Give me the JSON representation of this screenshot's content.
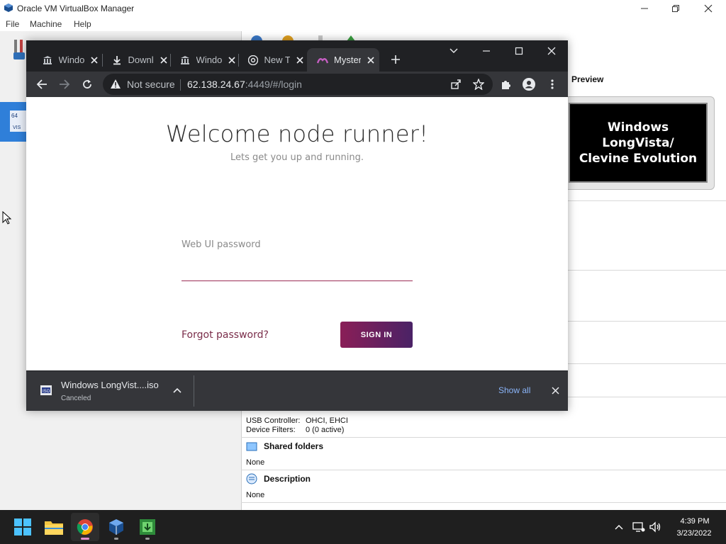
{
  "vbox": {
    "title": "Oracle VM VirtualBox Manager",
    "menu": [
      "File",
      "Machine",
      "Help"
    ],
    "preview_label": "Preview",
    "preview_text_line1": "Windows LongVista/",
    "preview_text_line2": "Clevine Evolution",
    "usb_controller_label": "USB Controller:",
    "usb_controller_value": "OHCI, EHCI",
    "device_filters_label": "Device Filters:",
    "device_filters_value": "0 (0 active)",
    "shared_folders_title": "Shared folders",
    "shared_folders_value": "None",
    "description_title": "Description",
    "description_value": "None"
  },
  "chrome": {
    "tabs": [
      {
        "label": "Windows",
        "icon": "bank-icon",
        "active": false
      },
      {
        "label": "Download",
        "icon": "download-icon",
        "active": false
      },
      {
        "label": "Windows",
        "icon": "bank-icon",
        "active": false
      },
      {
        "label": "New Tab",
        "icon": "chrome-icon",
        "active": false
      },
      {
        "label": "Mysterium",
        "icon": "mysterium-icon",
        "active": true
      }
    ],
    "security_label": "Not secure",
    "url_host": "62.138.24.67",
    "url_rest": ":4449/#/login"
  },
  "page": {
    "welcome": "Welcome node runner!",
    "subtitle": "Lets get you up and running.",
    "password_label": "Web UI password",
    "password_value": "",
    "forgot_link": "Forgot password?",
    "signin_button": "SIGN IN",
    "accent_color": "#9b2d55"
  },
  "download": {
    "filename": "Windows LongVist....iso",
    "status": "Canceled",
    "show_all": "Show all"
  },
  "taskbar": {
    "time": "4:39 PM",
    "date": "3/23/2022"
  }
}
